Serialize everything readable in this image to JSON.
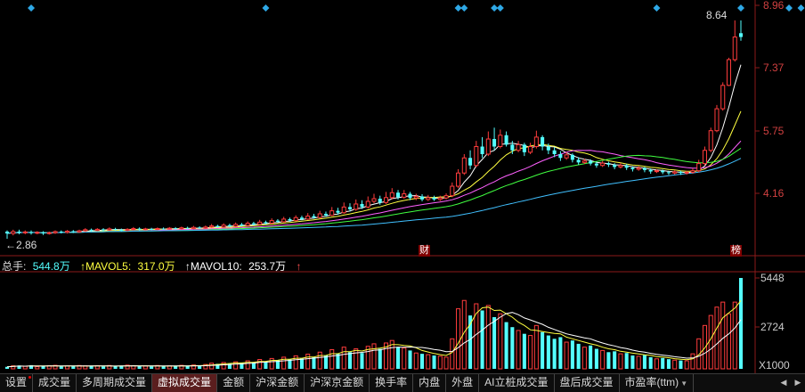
{
  "price_axis": {
    "labels": [
      "8.96",
      "7.37",
      "5.75",
      "4.16"
    ],
    "color": "#d04040"
  },
  "volume_axis": {
    "labels": [
      "5448",
      "2724"
    ],
    "unit": "X1000"
  },
  "annotations": {
    "high": "8.64",
    "low": "2.86",
    "low_arrow": "←"
  },
  "event_markers": {
    "cai": "财",
    "bang": "榜"
  },
  "volume_legend": {
    "total_label": "总手:",
    "total_value": "544.8万",
    "mavol5_label": "↑MAVOL5:",
    "mavol5_value": "317.0万",
    "mavol10_label": "↑MAVOL10:",
    "mavol10_value": "253.7万",
    "trend_arrow": "↑"
  },
  "tabs": [
    "设置",
    "成交量",
    "多周期成交量",
    "虚拟成交量",
    "金额",
    "沪深金额",
    "沪深京金额",
    "换手率",
    "内盘",
    "外盘",
    "AI立桩成交量",
    "盘后成交量",
    "市盈率(ttm)"
  ],
  "active_tab": "虚拟成交量",
  "nav": {
    "prev": "◀",
    "next": "▶"
  },
  "colors": {
    "up": "#ff3c3c",
    "down": "#54ffff",
    "ma5": "#ffffff",
    "ma10": "#ffff40",
    "ma20": "#ff60ff",
    "ma30": "#40ff40",
    "ma60": "#40c0ff",
    "diamond": "#2ea8e6",
    "grid": "#8b1a1a"
  },
  "chart_data": {
    "type": "candlestick",
    "price_ylim": [
      2.3,
      9.2
    ],
    "volume_ylim": [
      0,
      5448
    ],
    "volume_unit": "X1000",
    "price_ticks": [
      8.96,
      7.37,
      5.75,
      4.16
    ],
    "volume_ticks": [
      5448,
      2724
    ],
    "high_label": 8.64,
    "low_label": 2.86,
    "signal_diamonds_at_index": [
      4,
      43,
      75,
      76,
      81,
      82,
      108,
      122,
      130,
      132
    ],
    "candles": [
      [
        3.05,
        3.0,
        3.08,
        2.86,
        120,
        "d"
      ],
      [
        3.0,
        3.05,
        3.1,
        2.95,
        180,
        "u"
      ],
      [
        3.05,
        3.02,
        3.1,
        2.98,
        200,
        "d"
      ],
      [
        3.02,
        3.04,
        3.08,
        2.98,
        150,
        "u"
      ],
      [
        3.04,
        3.01,
        3.08,
        2.97,
        220,
        "d"
      ],
      [
        3.01,
        3.03,
        3.06,
        2.98,
        130,
        "u"
      ],
      [
        3.03,
        3.0,
        3.06,
        2.96,
        160,
        "d"
      ],
      [
        3.0,
        3.02,
        3.05,
        2.97,
        190,
        "u"
      ],
      [
        3.02,
        3.05,
        3.08,
        2.99,
        210,
        "u"
      ],
      [
        3.05,
        3.03,
        3.08,
        3.0,
        140,
        "d"
      ],
      [
        3.03,
        3.06,
        3.09,
        3.0,
        170,
        "u"
      ],
      [
        3.06,
        3.04,
        3.09,
        3.01,
        150,
        "d"
      ],
      [
        3.04,
        3.07,
        3.1,
        3.02,
        200,
        "u"
      ],
      [
        3.07,
        3.1,
        3.14,
        3.04,
        180,
        "u"
      ],
      [
        3.1,
        3.08,
        3.13,
        3.05,
        160,
        "d"
      ],
      [
        3.08,
        3.11,
        3.14,
        3.06,
        190,
        "u"
      ],
      [
        3.11,
        3.09,
        3.14,
        3.06,
        140,
        "d"
      ],
      [
        3.09,
        3.12,
        3.16,
        3.07,
        200,
        "u"
      ],
      [
        3.12,
        3.1,
        3.15,
        3.08,
        150,
        "d"
      ],
      [
        3.1,
        3.08,
        3.13,
        3.06,
        180,
        "d"
      ],
      [
        3.08,
        3.11,
        3.14,
        3.06,
        220,
        "u"
      ],
      [
        3.11,
        3.13,
        3.17,
        3.09,
        190,
        "u"
      ],
      [
        3.13,
        3.1,
        3.16,
        3.08,
        160,
        "d"
      ],
      [
        3.1,
        3.12,
        3.15,
        3.08,
        170,
        "u"
      ],
      [
        3.12,
        3.11,
        3.15,
        3.09,
        140,
        "d"
      ],
      [
        3.11,
        3.13,
        3.16,
        3.09,
        200,
        "u"
      ],
      [
        3.13,
        3.12,
        3.16,
        3.1,
        150,
        "d"
      ],
      [
        3.12,
        3.14,
        3.17,
        3.1,
        180,
        "u"
      ],
      [
        3.14,
        3.12,
        3.17,
        3.1,
        160,
        "d"
      ],
      [
        3.12,
        3.15,
        3.18,
        3.1,
        210,
        "u"
      ],
      [
        3.15,
        3.13,
        3.18,
        3.11,
        170,
        "d"
      ],
      [
        3.13,
        3.16,
        3.2,
        3.11,
        230,
        "u"
      ],
      [
        3.16,
        3.14,
        3.19,
        3.12,
        180,
        "d"
      ],
      [
        3.14,
        3.17,
        3.21,
        3.12,
        260,
        "u"
      ],
      [
        3.17,
        3.2,
        3.25,
        3.15,
        340,
        "u"
      ],
      [
        3.2,
        3.17,
        3.23,
        3.15,
        300,
        "d"
      ],
      [
        3.17,
        3.22,
        3.27,
        3.15,
        380,
        "u"
      ],
      [
        3.22,
        3.19,
        3.26,
        3.17,
        320,
        "d"
      ],
      [
        3.19,
        3.24,
        3.29,
        3.17,
        420,
        "u"
      ],
      [
        3.24,
        3.21,
        3.28,
        3.19,
        350,
        "d"
      ],
      [
        3.21,
        3.27,
        3.32,
        3.19,
        480,
        "u"
      ],
      [
        3.27,
        3.24,
        3.31,
        3.21,
        410,
        "d"
      ],
      [
        3.24,
        3.3,
        3.36,
        3.22,
        560,
        "u"
      ],
      [
        3.3,
        3.27,
        3.34,
        3.24,
        450,
        "d"
      ],
      [
        3.27,
        3.34,
        3.4,
        3.25,
        620,
        "u"
      ],
      [
        3.34,
        3.31,
        3.38,
        3.28,
        520,
        "d"
      ],
      [
        3.31,
        3.38,
        3.44,
        3.29,
        700,
        "u"
      ],
      [
        3.38,
        3.34,
        3.42,
        3.31,
        560,
        "d"
      ],
      [
        3.34,
        3.42,
        3.48,
        3.32,
        780,
        "u"
      ],
      [
        3.42,
        3.38,
        3.47,
        3.35,
        620,
        "d"
      ],
      [
        3.38,
        3.46,
        3.54,
        3.36,
        880,
        "u"
      ],
      [
        3.46,
        3.42,
        3.52,
        3.39,
        700,
        "d"
      ],
      [
        3.42,
        3.52,
        3.6,
        3.4,
        1000,
        "u"
      ],
      [
        3.52,
        3.48,
        3.58,
        3.44,
        800,
        "d"
      ],
      [
        3.48,
        3.6,
        3.7,
        3.46,
        1150,
        "u"
      ],
      [
        3.6,
        3.55,
        3.68,
        3.5,
        900,
        "d"
      ],
      [
        3.55,
        3.7,
        3.82,
        3.52,
        1300,
        "u"
      ],
      [
        3.7,
        3.64,
        3.8,
        3.58,
        1000,
        "d"
      ],
      [
        3.64,
        3.78,
        3.9,
        3.6,
        1200,
        "u"
      ],
      [
        3.78,
        3.7,
        3.88,
        3.65,
        950,
        "d"
      ],
      [
        3.7,
        3.85,
        3.98,
        3.66,
        1350,
        "u"
      ],
      [
        3.85,
        3.92,
        4.05,
        3.8,
        1500,
        "u"
      ],
      [
        3.92,
        3.82,
        4.0,
        3.76,
        1200,
        "d"
      ],
      [
        3.82,
        3.95,
        4.1,
        3.78,
        1550,
        "u"
      ],
      [
        3.95,
        4.08,
        4.2,
        3.9,
        1700,
        "u"
      ],
      [
        4.08,
        3.96,
        4.15,
        3.9,
        1300,
        "d"
      ],
      [
        3.96,
        4.05,
        4.15,
        3.92,
        1250,
        "u"
      ],
      [
        4.05,
        3.94,
        4.1,
        3.88,
        1100,
        "d"
      ],
      [
        3.94,
        3.98,
        4.05,
        3.88,
        950,
        "u"
      ],
      [
        3.98,
        3.9,
        4.04,
        3.85,
        900,
        "d"
      ],
      [
        3.9,
        3.95,
        4.02,
        3.86,
        850,
        "u"
      ],
      [
        3.95,
        3.9,
        4.0,
        3.86,
        800,
        "d"
      ],
      [
        3.9,
        3.94,
        4.0,
        3.86,
        760,
        "u"
      ],
      [
        3.94,
        4.0,
        4.06,
        3.9,
        700,
        "u"
      ],
      [
        4.0,
        4.25,
        4.35,
        3.96,
        1800,
        "u"
      ],
      [
        4.25,
        4.6,
        4.7,
        4.2,
        3600,
        "u"
      ],
      [
        4.6,
        5.0,
        5.1,
        4.55,
        4100,
        "u"
      ],
      [
        5.0,
        4.8,
        5.2,
        4.7,
        3200,
        "d"
      ],
      [
        4.8,
        5.3,
        5.45,
        4.75,
        3900,
        "u"
      ],
      [
        5.3,
        5.1,
        5.55,
        5.0,
        3500,
        "d"
      ],
      [
        5.1,
        5.5,
        5.7,
        5.05,
        3800,
        "u"
      ],
      [
        5.5,
        5.3,
        5.8,
        5.2,
        3100,
        "d"
      ],
      [
        5.3,
        5.6,
        5.75,
        5.25,
        3300,
        "u"
      ],
      [
        5.6,
        5.35,
        5.7,
        5.3,
        2800,
        "d"
      ],
      [
        5.35,
        5.2,
        5.45,
        5.1,
        2500,
        "d"
      ],
      [
        5.2,
        5.35,
        5.45,
        5.15,
        2300,
        "u"
      ],
      [
        5.35,
        5.15,
        5.4,
        5.05,
        2100,
        "d"
      ],
      [
        5.15,
        5.3,
        5.4,
        5.1,
        2000,
        "u"
      ],
      [
        5.3,
        5.55,
        5.72,
        5.25,
        2600,
        "u"
      ],
      [
        5.55,
        5.3,
        5.6,
        5.2,
        2200,
        "d"
      ],
      [
        5.3,
        5.2,
        5.38,
        5.1,
        2000,
        "d"
      ],
      [
        5.2,
        5.1,
        5.28,
        5.02,
        1800,
        "d"
      ],
      [
        5.1,
        5.0,
        5.18,
        4.92,
        1900,
        "d"
      ],
      [
        5.0,
        5.08,
        5.15,
        4.95,
        1600,
        "u"
      ],
      [
        5.08,
        4.95,
        5.12,
        4.88,
        1700,
        "d"
      ],
      [
        4.95,
        4.88,
        5.02,
        4.82,
        1500,
        "d"
      ],
      [
        4.88,
        4.92,
        4.98,
        4.84,
        1300,
        "u"
      ],
      [
        4.92,
        4.85,
        4.96,
        4.8,
        1400,
        "d"
      ],
      [
        4.85,
        4.8,
        4.9,
        4.74,
        1200,
        "d"
      ],
      [
        4.8,
        4.86,
        4.92,
        4.76,
        1100,
        "u"
      ],
      [
        4.86,
        4.82,
        4.9,
        4.76,
        1000,
        "d"
      ],
      [
        4.82,
        4.76,
        4.86,
        4.7,
        1050,
        "d"
      ],
      [
        4.76,
        4.8,
        4.86,
        4.72,
        900,
        "u"
      ],
      [
        4.8,
        4.74,
        4.84,
        4.68,
        950,
        "d"
      ],
      [
        4.74,
        4.7,
        4.78,
        4.64,
        800,
        "d"
      ],
      [
        4.7,
        4.73,
        4.78,
        4.66,
        750,
        "u"
      ],
      [
        4.73,
        4.68,
        4.76,
        4.62,
        820,
        "d"
      ],
      [
        4.68,
        4.64,
        4.72,
        4.58,
        700,
        "d"
      ],
      [
        4.64,
        4.66,
        4.7,
        4.6,
        600,
        "u"
      ],
      [
        4.66,
        4.62,
        4.69,
        4.57,
        650,
        "d"
      ],
      [
        4.62,
        4.6,
        4.66,
        4.55,
        580,
        "d"
      ],
      [
        4.6,
        4.63,
        4.67,
        4.56,
        520,
        "u"
      ],
      [
        4.63,
        4.6,
        4.66,
        4.55,
        500,
        "d"
      ],
      [
        4.6,
        4.62,
        4.66,
        4.56,
        480,
        "u"
      ],
      [
        4.62,
        4.66,
        4.72,
        4.58,
        900,
        "u"
      ],
      [
        4.66,
        4.85,
        4.95,
        4.62,
        1800,
        "u"
      ],
      [
        4.85,
        5.2,
        5.3,
        4.8,
        2600,
        "u"
      ],
      [
        5.2,
        5.72,
        5.8,
        5.15,
        3200,
        "u"
      ],
      [
        5.72,
        6.3,
        6.4,
        5.68,
        3700,
        "u"
      ],
      [
        6.3,
        6.92,
        7.0,
        6.25,
        4000,
        "u"
      ],
      [
        6.92,
        7.6,
        7.65,
        6.9,
        3300,
        "u"
      ],
      [
        7.6,
        8.2,
        8.64,
        7.55,
        4000,
        "u"
      ],
      [
        8.2,
        8.3,
        8.64,
        8.1,
        5448,
        "d"
      ]
    ],
    "ma_lines": [
      "MA5",
      "MA10",
      "MA20",
      "MA30",
      "MA60"
    ],
    "volume_ma": [
      "MAVOL5",
      "MAVOL10"
    ]
  }
}
